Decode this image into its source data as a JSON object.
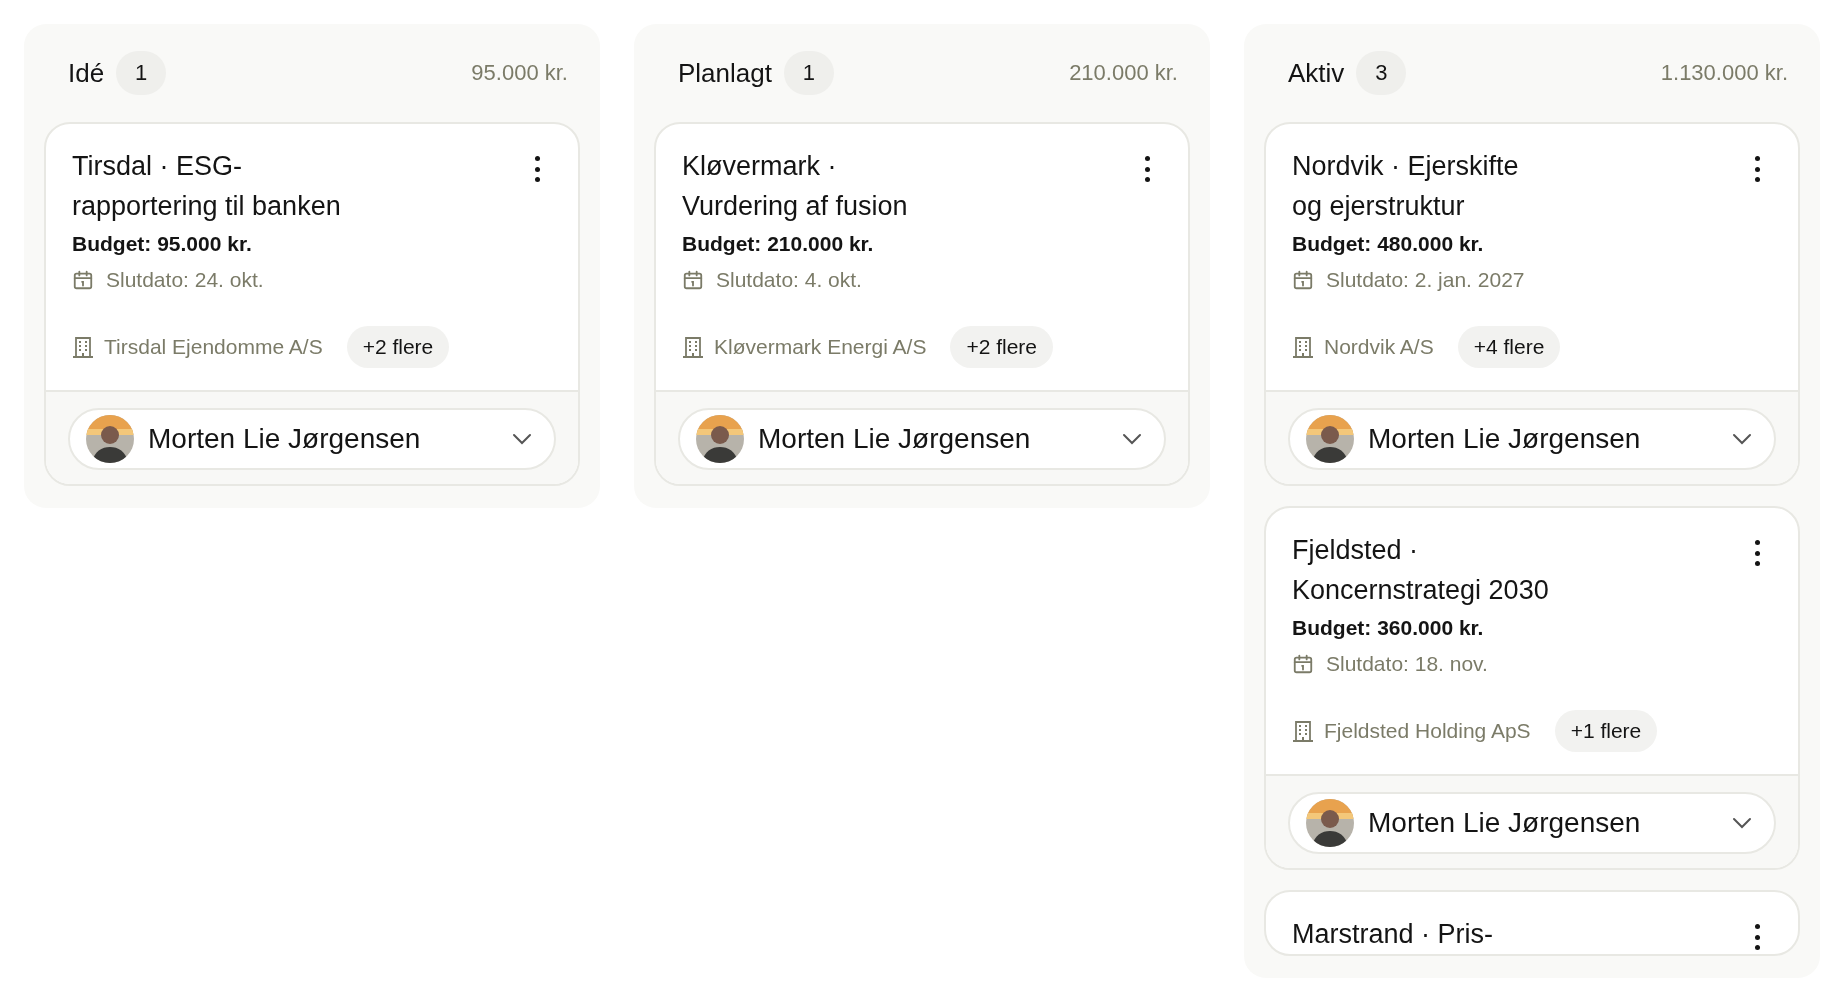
{
  "columns": [
    {
      "name": "Idé",
      "count": "1",
      "total": "95.000 kr.",
      "cards": [
        {
          "title": "Tirsdal · ESG-rapportering til banken",
          "budget": "Budget: 95.000 kr.",
          "end_date": "Slutdato: 24. okt.",
          "company": "Tirsdal Ejendomme A/S",
          "more": "+2 flere",
          "owner": "Morten Lie Jørgensen"
        }
      ]
    },
    {
      "name": "Planlagt",
      "count": "1",
      "total": "210.000 kr.",
      "cards": [
        {
          "title": "Kløvermark · Vurdering af fusion",
          "budget": "Budget: 210.000 kr.",
          "end_date": "Slutdato: 4. okt.",
          "company": "Kløvermark Energi A/S",
          "more": "+2 flere",
          "owner": "Morten Lie Jørgensen"
        }
      ]
    },
    {
      "name": "Aktiv",
      "count": "3",
      "total": "1.130.000 kr.",
      "cards": [
        {
          "title": "Nordvik · Ejerskifte og ejerstruktur",
          "budget": "Budget: 480.000 kr.",
          "end_date": "Slutdato: 2. jan. 2027",
          "company": "Nordvik A/S",
          "more": "+4 flere",
          "owner": "Morten Lie Jørgensen"
        },
        {
          "title": "Fjeldsted · Koncernstrategi 2030",
          "budget": "Budget: 360.000 kr.",
          "end_date": "Slutdato: 18. nov.",
          "company": "Fjeldsted Holding ApS",
          "more": "+1 flere",
          "owner": "Morten Lie Jørgensen"
        },
        {
          "title": "Marstrand · Pris-"
        }
      ]
    }
  ]
}
